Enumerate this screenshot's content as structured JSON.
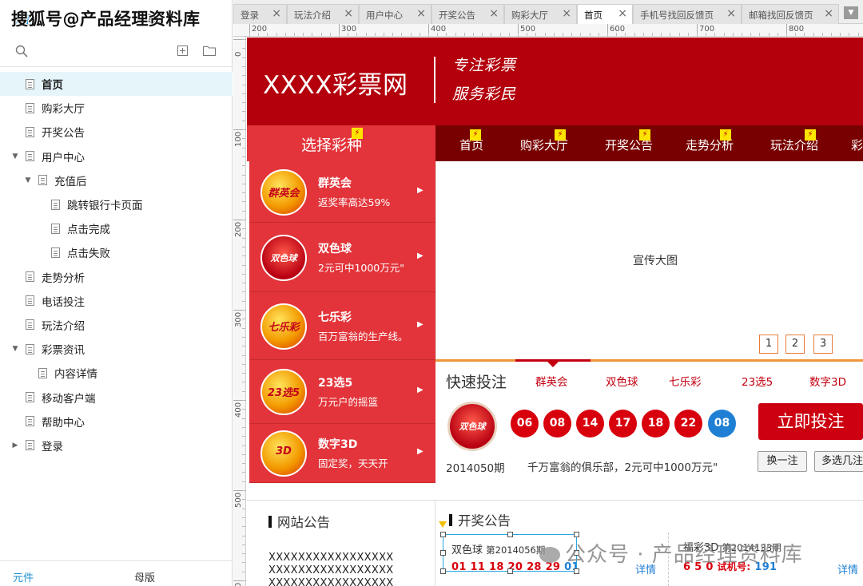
{
  "left_panel": {
    "header_tabs": [
      "页面",
      "概要"
    ],
    "watermark_top": "搜狐号@产品经理资料库",
    "tree": [
      {
        "label": "首页",
        "level": 0,
        "caret": "",
        "selected": true
      },
      {
        "label": "购彩大厅",
        "level": 0,
        "caret": ""
      },
      {
        "label": "开奖公告",
        "level": 0,
        "caret": ""
      },
      {
        "label": "用户中心",
        "level": 0,
        "caret": "▼"
      },
      {
        "label": "充值后",
        "level": 1,
        "caret": "▼"
      },
      {
        "label": "跳转银行卡页面",
        "level": 2,
        "caret": ""
      },
      {
        "label": "点击完成",
        "level": 2,
        "caret": ""
      },
      {
        "label": "点击失败",
        "level": 2,
        "caret": ""
      },
      {
        "label": "走势分析",
        "level": 0,
        "caret": ""
      },
      {
        "label": "电话投注",
        "level": 0,
        "caret": ""
      },
      {
        "label": "玩法介绍",
        "level": 0,
        "caret": ""
      },
      {
        "label": "彩票资讯",
        "level": 0,
        "caret": "▼"
      },
      {
        "label": "内容详情",
        "level": 1,
        "caret": ""
      },
      {
        "label": "移动客户端",
        "level": 0,
        "caret": ""
      },
      {
        "label": "帮助中心",
        "level": 0,
        "caret": ""
      },
      {
        "label": "登录",
        "level": 0,
        "caret": "▶"
      }
    ],
    "bottom_tabs": [
      "元件",
      "母版"
    ]
  },
  "tabs": [
    {
      "label": "登录",
      "active": false
    },
    {
      "label": "玩法介绍",
      "active": false
    },
    {
      "label": "用户中心",
      "active": false
    },
    {
      "label": "开奖公告",
      "active": false
    },
    {
      "label": "购彩大厅",
      "active": false
    },
    {
      "label": "首页",
      "active": true
    },
    {
      "label": "手机号找回反馈页",
      "active": false
    },
    {
      "label": "邮箱找回反馈页",
      "active": false
    }
  ],
  "ruler": {
    "top_labels": [
      "200",
      "300",
      "400",
      "500",
      "600",
      "700",
      "800"
    ],
    "left_labels": [
      "0",
      "100",
      "200",
      "300",
      "400",
      "500",
      "600"
    ]
  },
  "site": {
    "logo": "XXXX彩票网",
    "slogan_lines": [
      "专注彩票",
      "服务彩民"
    ],
    "choose_label": "选择彩种",
    "nav": [
      "首页",
      "购彩大厅",
      "开奖公告",
      "走势分析",
      "玩法介绍",
      "彩"
    ],
    "lotteries": [
      {
        "logo_text": "群英会",
        "name": "群英会",
        "desc": "返奖率高达59%"
      },
      {
        "logo_text": "双色球",
        "name": "双色球",
        "desc": "2元可中1000万元\""
      },
      {
        "logo_text": "七乐彩",
        "name": "七乐彩",
        "desc": "百万富翁的生产线。"
      },
      {
        "logo_text": "23选5",
        "name": "23选5",
        "desc": "万元户的摇篮"
      },
      {
        "logo_text": "3D",
        "name": "数字3D",
        "desc": "固定奖，天天开"
      }
    ],
    "banner_label": "宣传大图",
    "banner_pages": [
      "1",
      "2",
      "3"
    ],
    "quick": {
      "title": "快速投注",
      "tabs": [
        "群英会",
        "双色球",
        "七乐彩",
        "23选5",
        "数字3D"
      ],
      "logo_text": "双色球",
      "red_balls": [
        "06",
        "08",
        "14",
        "17",
        "18",
        "22"
      ],
      "blue_ball": "08",
      "bet_button": "立即投注",
      "period": "2014050期",
      "slogan": "千万富翁的俱乐部，2元可中1000万元\"",
      "change_button": "换一注",
      "multi_button": "多选几注"
    },
    "notice": {
      "title": "网站公告",
      "lines": [
        "XXXXXXXXXXXXXXXXX",
        "XXXXXXXXXXXXXXXXX",
        "XXXXXXXXXXXXXXXXX"
      ]
    },
    "draw": {
      "title": "开奖公告",
      "cards": [
        {
          "game": "双色球",
          "issue": "第2014056期",
          "numbers": "01 11 18 20 28 29",
          "blue": "01",
          "detail": "详情"
        },
        {
          "game": "福彩3D",
          "issue": "第2014133期",
          "numbers": "6 5 0",
          "trial_label": "试机号:",
          "trial": "191",
          "detail": "详情"
        }
      ]
    }
  },
  "watermark_bottom": "公众号 · 产品经理资料库",
  "colors": {
    "header_red": "#b3000c",
    "nav_dark": "#780000",
    "panel_red": "#e2343a",
    "accent_orange": "#f0953a",
    "ball_red": "#d8000c",
    "ball_blue": "#1f7fd4",
    "selection_blue": "#2aa6e0"
  }
}
